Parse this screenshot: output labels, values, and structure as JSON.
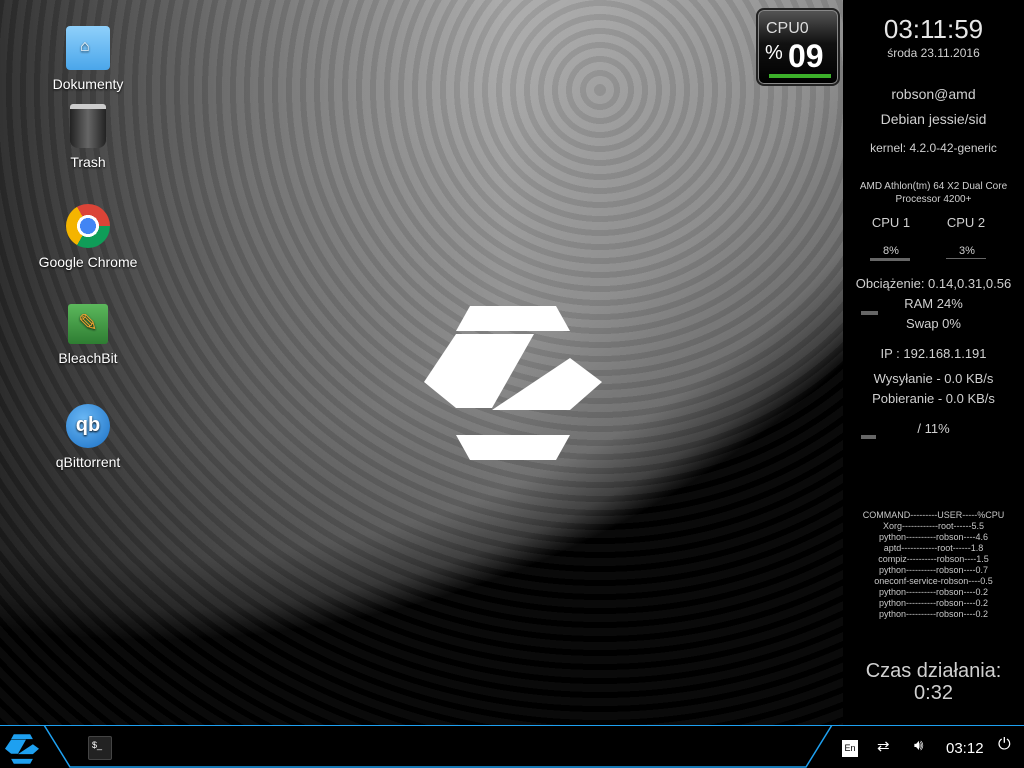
{
  "desktop_icons": [
    {
      "label": "Dokumenty",
      "icon": "folder-home-icon"
    },
    {
      "label": "Trash",
      "icon": "trash-icon"
    },
    {
      "label": "Google Chrome",
      "icon": "chrome-icon"
    },
    {
      "label": "BleachBit",
      "icon": "bleachbit-icon"
    },
    {
      "label": "qBittorrent",
      "icon": "qbittorrent-icon"
    }
  ],
  "cpu_widget": {
    "label": "CPU0",
    "percent_sign": "%",
    "value": "09",
    "fill": 0.09
  },
  "conky": {
    "time": "03:11:59",
    "date": "środa 23.11.2016",
    "user": "robson@amd",
    "distro": "Debian jessie/sid",
    "kernel": "kernel: 4.2.0-42-generic",
    "cpu_model_1": "AMD Athlon(tm) 64 X2 Dual Core",
    "cpu_model_2": "Processor 4200+",
    "cpu1_label": "CPU 1",
    "cpu2_label": "CPU 2",
    "cpu1_value": "8%",
    "cpu2_value": "3%",
    "load": "Obciążenie: 0.14,0.31,0.56",
    "ram": "RAM 24%",
    "ram_fraction": 0.24,
    "swap": "Swap 0%",
    "ip": "IP : 192.168.1.191",
    "upload": "Wysyłanie - 0.0 KB/s",
    "download": "Pobieranie - 0.0 KB/s",
    "disk": "/ 11%",
    "disk_fraction": 0.11,
    "processes": [
      "COMMAND---------USER-----%CPU",
      "Xorg------------root------5.5",
      "python----------robson----4.6",
      "aptd------------root------1.8",
      "compiz----------robson----1.5",
      "python----------robson----0.7",
      "oneconf-service-robson----0.5",
      "python----------robson----0.2",
      "python----------robson----0.2",
      "python----------robson----0.2"
    ],
    "uptime_label": "Czas działania:",
    "uptime": "0:32"
  },
  "taskbar": {
    "terminal_glyph": "$_",
    "keyboard": "En",
    "clock": "03:12",
    "accent": "#1ea0f0"
  }
}
